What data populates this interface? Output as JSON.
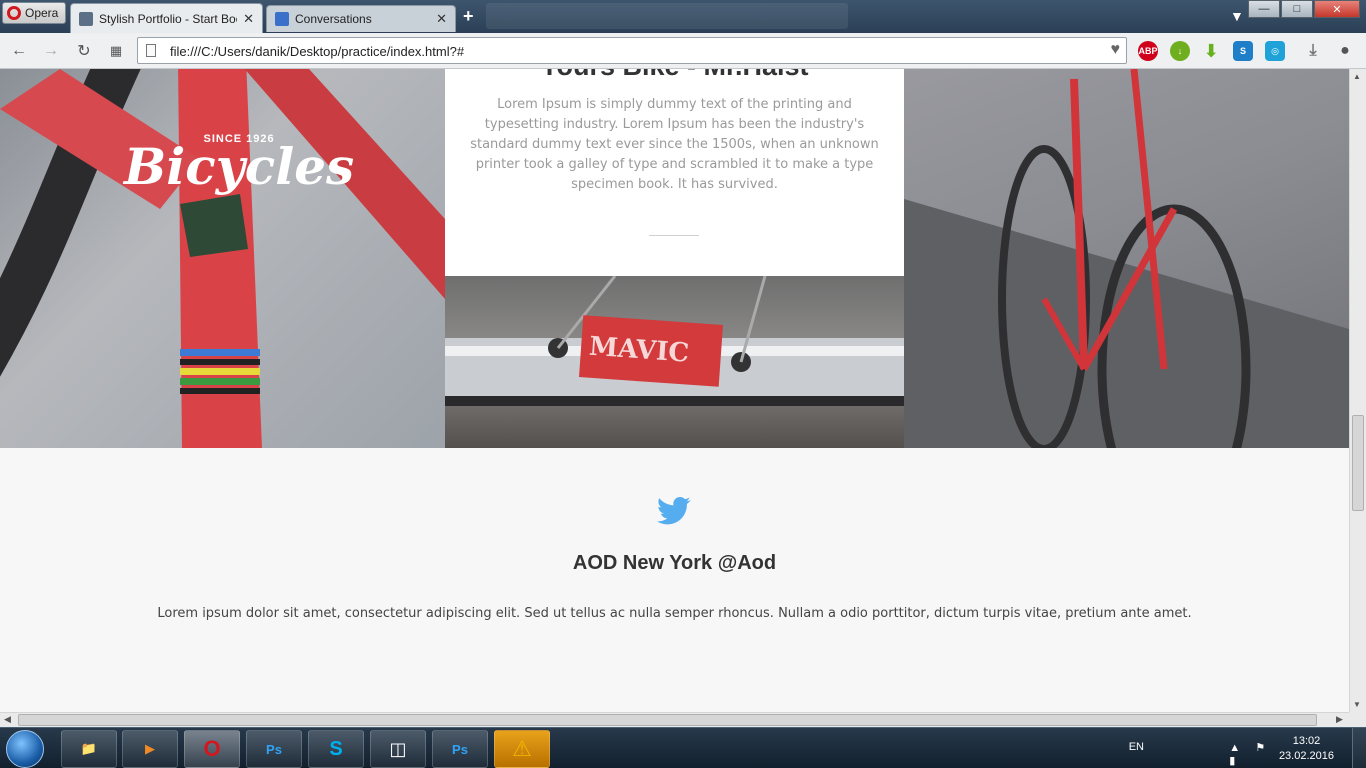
{
  "window": {
    "opera_button_label": "Opera",
    "tabs": [
      {
        "title": "Stylish Portfolio - Start Boo",
        "active": true,
        "favicon_color": "#5b6f86"
      },
      {
        "title": "Conversations",
        "active": false,
        "favicon_color": "#3a70c9"
      }
    ],
    "new_tab_label": "+",
    "controls": {
      "minimize": "—",
      "maximize": "□",
      "close": "✕"
    }
  },
  "toolbar": {
    "url": "file:///C:/Users/danik/Desktop/practice/index.html?#",
    "extensions": [
      {
        "name": "adblock-plus-icon",
        "label": "ABP",
        "color": "#d0021b"
      },
      {
        "name": "download-green-icon",
        "label": "↓",
        "color": "#6fae1e"
      },
      {
        "name": "download-arrow-icon",
        "label": "⬇",
        "color": "#67b11f"
      },
      {
        "name": "s-extension-icon",
        "label": "S",
        "color": "#1e7ec8"
      },
      {
        "name": "circle-extension-icon",
        "label": "◎",
        "color": "#1ea2d8"
      },
      {
        "name": "download-manager-icon",
        "label": "⤓",
        "color": "#777777"
      },
      {
        "name": "account-icon",
        "label": "●",
        "color": "#555555"
      }
    ]
  },
  "content": {
    "card_title": "Yours Bike - Mr.Halst",
    "card_body": "Lorem Ipsum is simply dummy text of the printing and typesetting industry. Lorem Ipsum has been the industry's standard dummy text ever since the 1500s, when an unknown printer took a galley of type and scrambled it to make a type specimen book. It has survived.",
    "logo_since": "SINCE 1926",
    "logo_brand": "Bicycles",
    "mavic_label": "MAVIC",
    "tweet_heading": "AOD New York @Aod",
    "tweet_text": "Lorem ipsum dolor sit amet, consectetur adipiscing elit. Sed ut tellus ac nulla semper rhoncus. Nullam a odio porttitor, dictum turpis vitae, pretium ante amet.",
    "accent_color": "#55acee"
  },
  "taskbar": {
    "apps": [
      {
        "name": "explorer-taskbar-button",
        "label": "📁",
        "color": "#e7c35b"
      },
      {
        "name": "media-player-taskbar-button",
        "label": "▶",
        "color": "#f08a24"
      },
      {
        "name": "opera-taskbar-button",
        "label": "O",
        "color": "#d2171e"
      },
      {
        "name": "photoshop-taskbar-button",
        "label": "Ps",
        "color": "#2fa3f6"
      },
      {
        "name": "skype-taskbar-button",
        "label": "S",
        "color": "#00aff0"
      },
      {
        "name": "bracket-app-taskbar-button",
        "label": "◫",
        "color": "#ffffff"
      },
      {
        "name": "photoshop-2-taskbar-button",
        "label": "Ps",
        "color": "#2fa3f6"
      },
      {
        "name": "warning-taskbar-button",
        "label": "⚠",
        "color": "#f2b400"
      }
    ],
    "language": "EN",
    "time": "13:02",
    "date": "23.02.2016"
  }
}
